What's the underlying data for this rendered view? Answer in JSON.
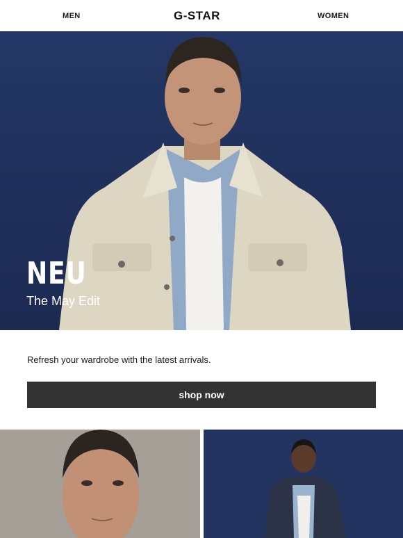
{
  "nav": {
    "men_label": "MEN",
    "brand_logo": "G-STAR",
    "women_label": "WOMEN"
  },
  "hero": {
    "title": "NEU",
    "subtitle": "The May Edit",
    "background_color": "#22345f"
  },
  "intro_text": "Refresh your wardrobe with the latest arrivals.",
  "cta": {
    "label": "shop now",
    "background_color": "#333333"
  },
  "tiles": {
    "left_background": "#a69f98",
    "right_background": "#22345f"
  }
}
